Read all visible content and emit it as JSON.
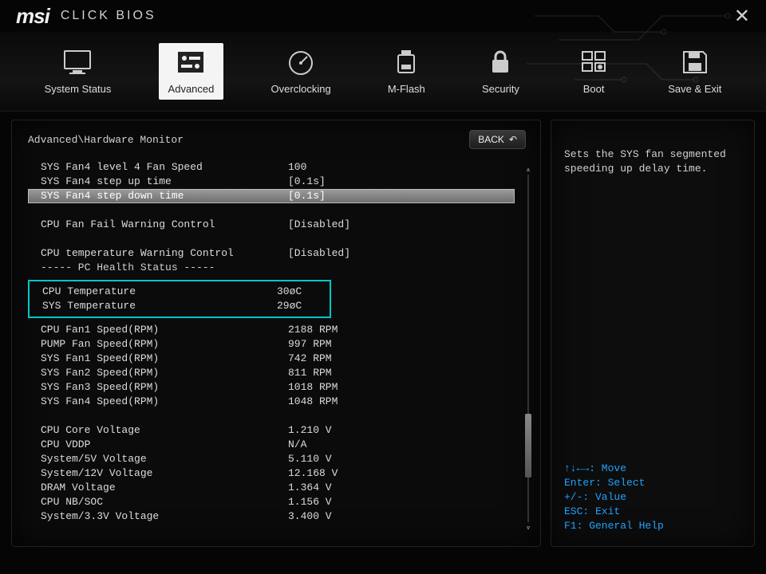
{
  "brand": {
    "logo": "msi",
    "product": "CLICK BIOS"
  },
  "nav": {
    "items": [
      {
        "label": "System Status"
      },
      {
        "label": "Advanced"
      },
      {
        "label": "Overclocking"
      },
      {
        "label": "M-Flash"
      },
      {
        "label": "Security"
      },
      {
        "label": "Boot"
      },
      {
        "label": "Save & Exit"
      }
    ],
    "active_index": 1
  },
  "breadcrumb": "Advanced\\Hardware Monitor",
  "back_label": "BACK",
  "settings": {
    "fan4_l4_speed": {
      "label": "SYS Fan4 level 4 Fan Speed",
      "value": "100"
    },
    "fan4_step_up": {
      "label": "SYS Fan4 step up time",
      "value": "[0.1s]"
    },
    "fan4_step_down": {
      "label": "SYS Fan4 step down time",
      "value": "[0.1s]"
    },
    "cpu_fan_fail": {
      "label": "CPU Fan Fail Warning Control",
      "value": "[Disabled]"
    },
    "cpu_temp_warn": {
      "label": "CPU temperature Warning Control",
      "value": "[Disabled]"
    },
    "section_health": "----- PC Health Status -----",
    "cpu_temp": {
      "label": "CPU Temperature",
      "value": "30øC"
    },
    "sys_temp": {
      "label": "SYS Temperature",
      "value": "29øC"
    },
    "cpu_fan1": {
      "label": "CPU Fan1 Speed(RPM)",
      "value": "2188 RPM"
    },
    "pump_fan": {
      "label": "PUMP Fan Speed(RPM)",
      "value": "997 RPM"
    },
    "sys_fan1": {
      "label": "SYS Fan1 Speed(RPM)",
      "value": "742 RPM"
    },
    "sys_fan2": {
      "label": "SYS Fan2 Speed(RPM)",
      "value": "811 RPM"
    },
    "sys_fan3": {
      "label": "SYS Fan3 Speed(RPM)",
      "value": "1018 RPM"
    },
    "sys_fan4": {
      "label": "SYS Fan4 Speed(RPM)",
      "value": "1048 RPM"
    },
    "vcore": {
      "label": "CPU Core Voltage",
      "value": "1.210 V"
    },
    "vddp": {
      "label": "CPU VDDP",
      "value": "N/A"
    },
    "v5": {
      "label": "System/5V Voltage",
      "value": "5.110 V"
    },
    "v12": {
      "label": "System/12V Voltage",
      "value": "12.168 V"
    },
    "dram": {
      "label": "DRAM Voltage",
      "value": "1.364 V"
    },
    "nbsoc": {
      "label": "CPU NB/SOC",
      "value": "1.156 V"
    },
    "v33": {
      "label": "System/3.3V Voltage",
      "value": "3.400 V"
    }
  },
  "help": {
    "description": "Sets the SYS fan segmented speeding up delay time.",
    "keys": {
      "move": "↑↓←→: Move",
      "select": "Enter: Select",
      "value": "+/-: Value",
      "exit": "ESC: Exit",
      "help": "F1: General Help"
    }
  }
}
